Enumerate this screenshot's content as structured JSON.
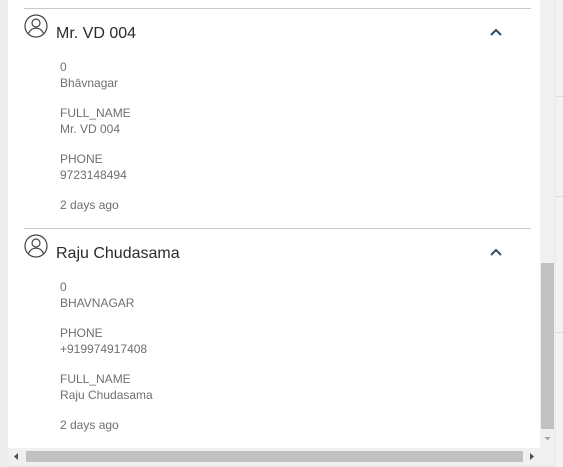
{
  "contacts": [
    {
      "name": "Mr. VD 004",
      "fields": [
        {
          "label": "0",
          "value": "Bhāvnagar"
        },
        {
          "label": "FULL_NAME",
          "value": "Mr. VD 004"
        },
        {
          "label": "PHONE",
          "value": "9723148494"
        }
      ],
      "time": "2 days ago",
      "icon": "user-circle-icon",
      "toggle_icon": "chevron-up-icon"
    },
    {
      "name": "Raju Chudasama",
      "fields": [
        {
          "label": "0",
          "value": "BHAVNAGAR"
        },
        {
          "label": "PHONE",
          "value": "+919974917408"
        },
        {
          "label": "FULL_NAME",
          "value": "Raju Chudasama"
        }
      ],
      "time": "2 days ago",
      "icon": "user-circle-icon",
      "toggle_icon": "chevron-up-icon"
    }
  ],
  "colors": {
    "panel_bg": "#ffffff",
    "chevron": "#2f4a63",
    "text_secondary": "#6f6f6f",
    "text_primary": "#2b2b2b"
  }
}
